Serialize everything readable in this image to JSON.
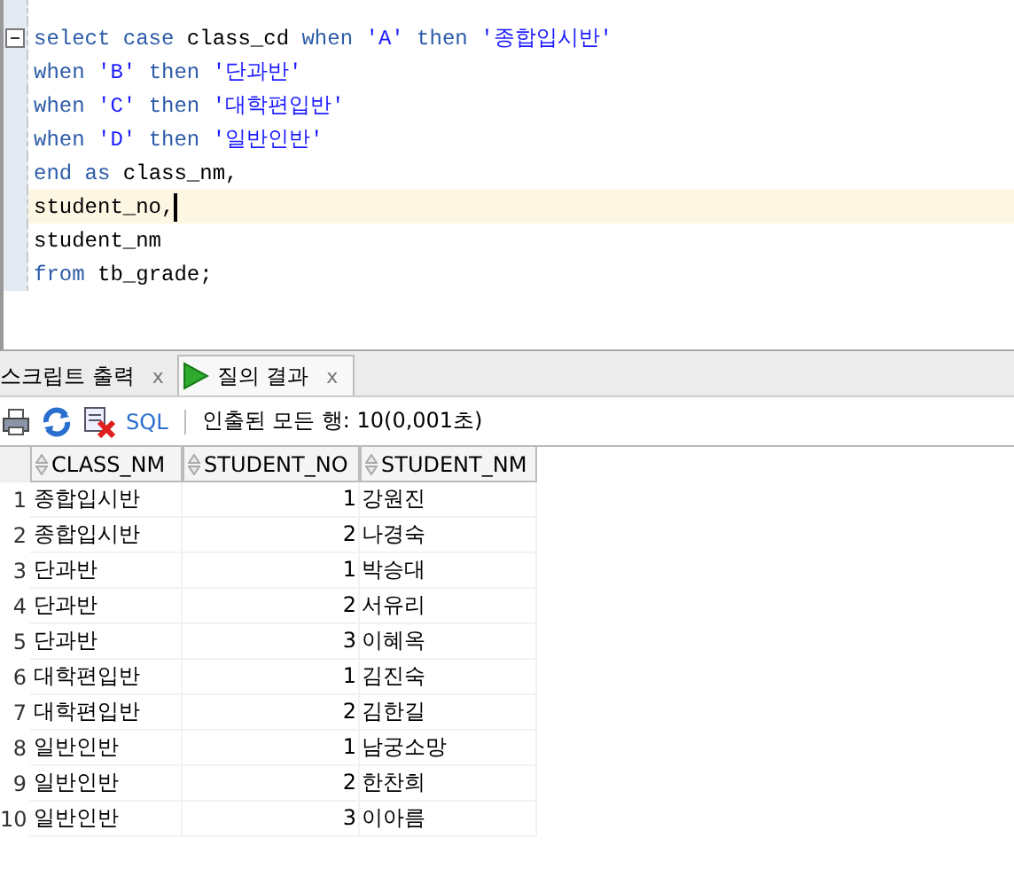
{
  "editor": {
    "lines": [
      {
        "current": false,
        "foldable": true,
        "tokens": [
          {
            "kind": "keyword",
            "text": "select case"
          },
          {
            "kind": "plain",
            "text": " class_cd "
          },
          {
            "kind": "keyword",
            "text": "when"
          },
          {
            "kind": "string",
            "text": " 'A'"
          },
          {
            "kind": "keyword",
            "text": " then"
          },
          {
            "kind": "string",
            "text": " '종합입시반'"
          }
        ]
      },
      {
        "current": false,
        "foldable": false,
        "tokens": [
          {
            "kind": "keyword",
            "text": "when"
          },
          {
            "kind": "string",
            "text": " 'B'"
          },
          {
            "kind": "keyword",
            "text": " then"
          },
          {
            "kind": "string",
            "text": " '단과반'"
          }
        ]
      },
      {
        "current": false,
        "foldable": false,
        "tokens": [
          {
            "kind": "keyword",
            "text": "when"
          },
          {
            "kind": "string",
            "text": " 'C'"
          },
          {
            "kind": "keyword",
            "text": " then"
          },
          {
            "kind": "string",
            "text": " '대학편입반'"
          }
        ]
      },
      {
        "current": false,
        "foldable": false,
        "tokens": [
          {
            "kind": "keyword",
            "text": "when"
          },
          {
            "kind": "string",
            "text": " 'D'"
          },
          {
            "kind": "keyword",
            "text": " then"
          },
          {
            "kind": "string",
            "text": " '일반인반'"
          }
        ]
      },
      {
        "current": false,
        "foldable": false,
        "tokens": [
          {
            "kind": "keyword",
            "text": "end as"
          },
          {
            "kind": "plain",
            "text": " class_nm,"
          }
        ]
      },
      {
        "current": true,
        "foldable": false,
        "tokens": [
          {
            "kind": "plain",
            "text": "student_no,"
          }
        ]
      },
      {
        "current": false,
        "foldable": false,
        "tokens": [
          {
            "kind": "plain",
            "text": "student_nm"
          }
        ]
      },
      {
        "current": false,
        "foldable": false,
        "tokens": [
          {
            "kind": "keyword",
            "text": "from"
          },
          {
            "kind": "plain",
            "text": " tb_grade;"
          }
        ]
      }
    ]
  },
  "tabs": [
    {
      "label": "스크립트 출력",
      "selected": false,
      "close": "x"
    },
    {
      "label": "질의 결과",
      "selected": true,
      "close": "x"
    }
  ],
  "toolbar": {
    "sql_link": "SQL",
    "status": "인출된 모든 행: 10(0,001초)"
  },
  "table": {
    "columns": [
      "CLASS_NM",
      "STUDENT_NO",
      "STUDENT_NM"
    ],
    "rows": [
      {
        "num": "1",
        "cells": [
          "종합입시반",
          "1",
          "강원진"
        ]
      },
      {
        "num": "2",
        "cells": [
          "종합입시반",
          "2",
          "나경숙"
        ]
      },
      {
        "num": "3",
        "cells": [
          "단과반",
          "1",
          "박승대"
        ]
      },
      {
        "num": "4",
        "cells": [
          "단과반",
          "2",
          "서유리"
        ]
      },
      {
        "num": "5",
        "cells": [
          "단과반",
          "3",
          "이혜옥"
        ]
      },
      {
        "num": "6",
        "cells": [
          "대학편입반",
          "1",
          "김진숙"
        ]
      },
      {
        "num": "7",
        "cells": [
          "대학편입반",
          "2",
          "김한길"
        ]
      },
      {
        "num": "8",
        "cells": [
          "일반인반",
          "1",
          "남궁소망"
        ]
      },
      {
        "num": "9",
        "cells": [
          "일반인반",
          "2",
          "한찬희"
        ]
      },
      {
        "num": "10",
        "cells": [
          "일반인반",
          "3",
          "이아름"
        ]
      }
    ]
  }
}
